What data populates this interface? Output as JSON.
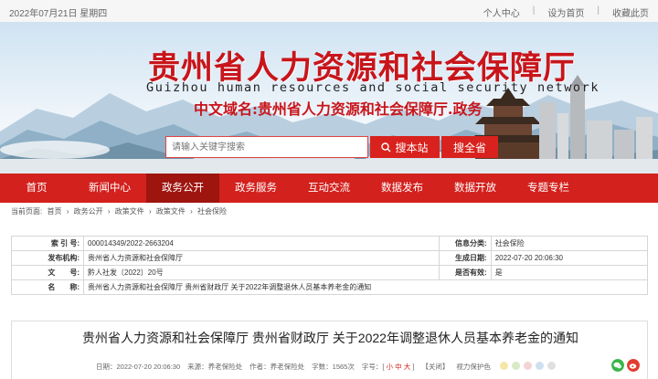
{
  "topbar": {
    "date": "2022年07月21日 星期四",
    "links": [
      "个人中心",
      "设为首页",
      "收藏此页"
    ]
  },
  "banner": {
    "title_cn": "贵州省人力资源和社会保障厅",
    "title_en": "Guizhou human resources and social security network",
    "domain": "中文域名:贵州省人力资源和社会保障厅.政务",
    "search_placeholder": "请输入关键字搜索",
    "search_button": "搜本站",
    "search_all_button": "搜全省"
  },
  "nav": {
    "items": [
      "首页",
      "新闻中心",
      "政务公开",
      "政务服务",
      "互动交流",
      "数据发布",
      "数据开放",
      "专题专栏"
    ],
    "active_index": 2,
    "active_color": "#9e1510",
    "bar_color": "#d3211d"
  },
  "breadcrumb": [
    "当前页面:",
    "首页",
    "›",
    "政务公开",
    "›",
    "政策文件",
    "›",
    "政策文件",
    "›",
    "社会保险"
  ],
  "info": {
    "index_label": "索 引 号:",
    "index_value": "000014349/2022-2663204",
    "class_label": "信息分类:",
    "class_value": "社会保险",
    "org_label": "发布机构:",
    "org_value": "贵州省人力资源和社会保障厅",
    "date_label": "生成日期:",
    "date_value": "2022-07-20 20:06:30",
    "doc_label": "文　　号:",
    "doc_value": "黔人社发〔2022〕20号",
    "valid_label": "是否有效:",
    "valid_value": "是",
    "name_label": "名　　称:",
    "name_value": "贵州省人力资源和社会保障厅 贵州省财政厅 关于2022年调整退休人员基本养老金的通知"
  },
  "article": {
    "title": "贵州省人力资源和社会保障厅 贵州省财政厅 关于2022年调整退休人员基本养老金的通知",
    "meta_date": "日期：2022-07-20 20:06:30",
    "meta_source": "来源：养老保险处",
    "meta_author": "作者：养老保险处",
    "meta_words": "字数：1565次",
    "meta_font_label": "字号：[",
    "font_small": "小",
    "font_mid": "中",
    "font_large": "大",
    "meta_font_end": "]",
    "meta_print": "【关闭】",
    "meta_vision": "视力保护色",
    "swatches": [
      "#f5e6a8",
      "#d8e9c6",
      "#f3d3d3",
      "#cce0f0",
      "#e0e0e0"
    ],
    "share_icons": [
      "wechat-icon",
      "weibo-icon"
    ]
  }
}
